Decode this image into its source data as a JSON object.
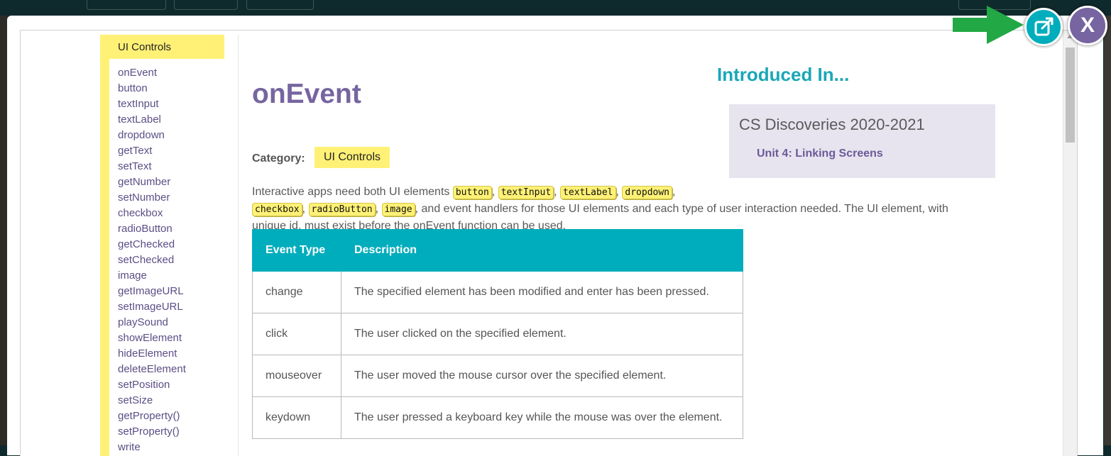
{
  "sidebar": {
    "heading": "UI Controls",
    "items": [
      "onEvent",
      "button",
      "textInput",
      "textLabel",
      "dropdown",
      "getText",
      "setText",
      "getNumber",
      "setNumber",
      "checkbox",
      "radioButton",
      "getChecked",
      "setChecked",
      "image",
      "getImageURL",
      "setImageURL",
      "playSound",
      "showElement",
      "hideElement",
      "deleteElement",
      "setPosition",
      "setSize",
      "getProperty()",
      "setProperty()",
      "write"
    ]
  },
  "doc": {
    "title": "onEvent",
    "category_label": "Category:",
    "category_value": "UI Controls",
    "intro_heading": "Introduced In...",
    "course": "CS Discoveries 2020-2021",
    "unit": "Unit 4: Linking Screens",
    "desc_prefix": "Interactive apps need both UI elements",
    "desc_suffix": ", and event handlers for those UI elements and each type of user interaction needed. The UI element, with",
    "desc_line3": "unique id, must exist before the onEvent function can be used.",
    "element_tags": [
      "button",
      "textInput",
      "textLabel",
      "dropdown",
      "checkbox",
      "radioButton",
      "image"
    ]
  },
  "table": {
    "headers": [
      "Event Type",
      "Description"
    ],
    "rows": [
      [
        "change",
        "The specified element has been modified and enter has been pressed."
      ],
      [
        "click",
        "The user clicked on the specified element."
      ],
      [
        "mouseover",
        "The user moved the mouse cursor over the specified element."
      ],
      [
        "keydown",
        "The user pressed a keyboard key while the mouse was over the element."
      ]
    ]
  },
  "controls": {
    "open_icon": "external-link-icon",
    "close_label": "X",
    "arrow_icon": "green-arrow-icon"
  },
  "colors": {
    "accent_teal": "#00adbc",
    "accent_purple": "#7665a0",
    "highlight_yellow": "#fff176",
    "arrow_green": "#22a845"
  }
}
